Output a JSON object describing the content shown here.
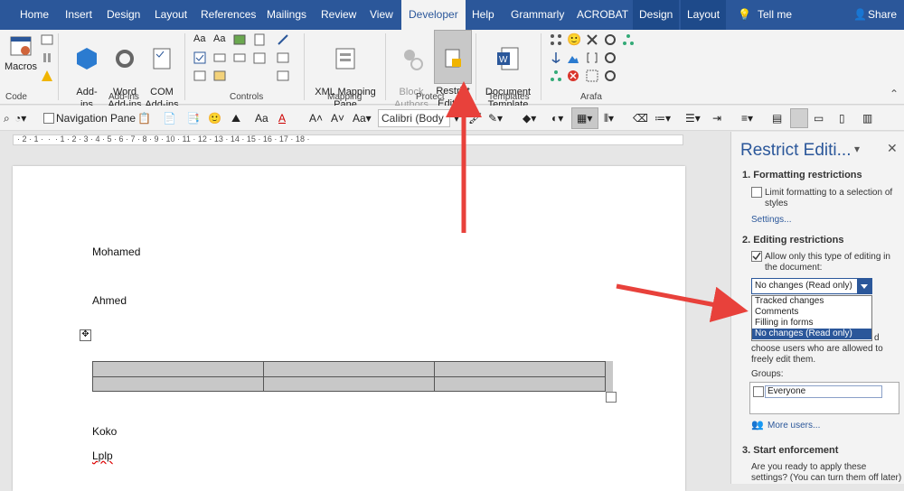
{
  "tabs": {
    "home": "Home",
    "insert": "Insert",
    "design": "Design",
    "layout": "Layout",
    "references": "References",
    "mailings": "Mailings",
    "review": "Review",
    "view": "View",
    "developer": "Developer",
    "help": "Help",
    "grammarly": "Grammarly",
    "acrobat": "ACROBAT",
    "ctx_design": "Design",
    "ctx_layout": "Layout",
    "tell_me": "Tell me",
    "share": "Share"
  },
  "ribbon": {
    "macros": "Macros",
    "code_group": "Code",
    "addins": "Add-\nins",
    "word_addins": "Word\nAdd-ins",
    "com_addins": "COM\nAdd-ins",
    "addins_group": "Add-ins",
    "controls_group": "Controls",
    "xml_mapping": "XML Mapping\nPane",
    "mapping_group": "Mapping",
    "block_authors": "Block\nAuthors",
    "restrict_editing": "Restrict\nEditing",
    "protect_group": "Protect",
    "document_template": "Document\nTemplate",
    "templates_group": "Templates",
    "arafa_group": "Arafa"
  },
  "toolbar": {
    "navigation_pane": "Navigation Pane",
    "font_name": "Calibri (Body",
    "aa": "Aa"
  },
  "ruler": {
    "ticks": "· 2 · 1 ·  ·  · 1 · 2 · 3 · 4 · 5 · 6 · 7 · 8 · 9 · 10 · 11 · 12 · 13 · 14 · 15 · 16 · 17 · 18 ·"
  },
  "document": {
    "line1": "Mohamed",
    "line2": "Ahmed",
    "line3": "Koko",
    "line4": "Lplp"
  },
  "pane": {
    "title": "Restrict Editi...",
    "section1": "1. Formatting restrictions",
    "limit_formatting": "Limit formatting to a selection of styles",
    "settings_link": "Settings...",
    "section2": "2. Editing restrictions",
    "allow_only": "Allow only this type of editing in the document:",
    "selected_option": "No changes (Read only)",
    "options": [
      "Tracked changes",
      "Comments",
      "Filling in forms",
      "No changes (Read only)"
    ],
    "exceptions_text": "choose users who are allowed to freely edit them.",
    "exceptions_fragment": "d",
    "groups_label": "Groups:",
    "everyone": "Everyone",
    "more_users": "More users...",
    "section3": "3. Start enforcement",
    "enforce_text": "Are you ready to apply these settings? (You can turn them off later)"
  },
  "colors": {
    "accent": "#2b579a",
    "arrow": "#e8413b"
  }
}
